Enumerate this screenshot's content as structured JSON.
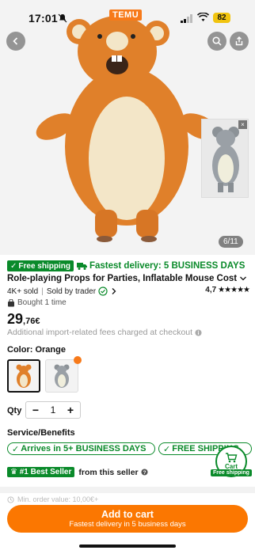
{
  "status_bar": {
    "time": "17:01",
    "battery": "82"
  },
  "brand": {
    "logo_text": "TEMU"
  },
  "gallery": {
    "counter": "6/11",
    "close_symbol": "×"
  },
  "badges": {
    "free_shipping": "Free shipping",
    "fastest_delivery": "Fastest delivery: 5 BUSINESS DAYS"
  },
  "product": {
    "title": "Role-playing Props for Parties, Inflatable Mouse Costume for",
    "sold": "4K+ sold",
    "sold_by": "Sold by trader",
    "rating": "4,7",
    "stars": "★★★★★",
    "bought": "Bought 1 time",
    "price_main": "29",
    "price_decimal": ",76€",
    "fees": "Additional import-related fees charged at checkout"
  },
  "color": {
    "label": "Color: Orange"
  },
  "quantity": {
    "label": "Qty",
    "minus": "−",
    "value": "1",
    "plus": "+"
  },
  "service": {
    "label": "Service/Benefits",
    "benefits": [
      "Arrives in 5+ BUSINESS DAYS",
      "FREE SHIPPING"
    ]
  },
  "seller": {
    "best_seller": "#1 Best Seller",
    "from_seller": "from this seller"
  },
  "cart_float": {
    "label": "Cart",
    "free_shipping": "Free shipping"
  },
  "min_order": "Min. order value: 10,00€+",
  "add_to_cart": {
    "title": "Add to cart",
    "subtitle": "Fastest delivery in 5 business days"
  },
  "colors": {
    "accent": "#fb7701",
    "green": "#0a8a2a",
    "costume_orange": "#e0802a",
    "belly": "#f3e6c8",
    "grey_costume": "#9aa0a6"
  }
}
